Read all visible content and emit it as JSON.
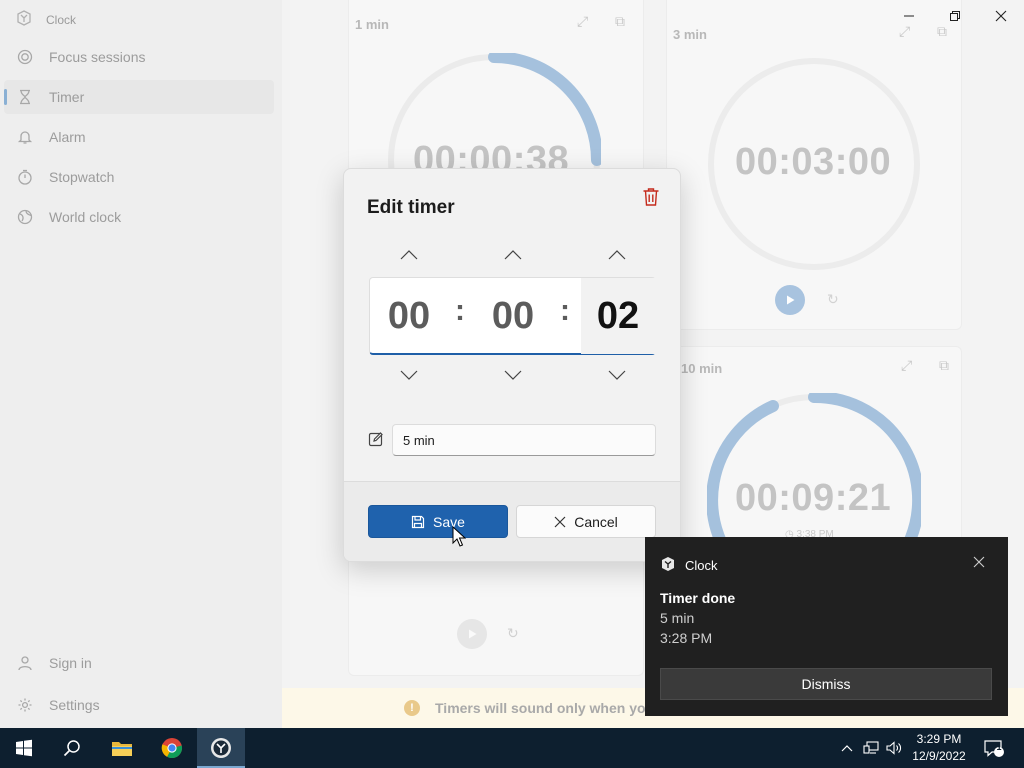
{
  "app": {
    "title": "Clock"
  },
  "sidebar": {
    "items": [
      {
        "label": "Focus sessions",
        "icon": "focus-icon"
      },
      {
        "label": "Timer",
        "icon": "hourglass-icon",
        "active": true
      },
      {
        "label": "Alarm",
        "icon": "bell-icon"
      },
      {
        "label": "Stopwatch",
        "icon": "stopwatch-icon"
      },
      {
        "label": "World clock",
        "icon": "globe-icon"
      }
    ],
    "bottom": [
      {
        "label": "Sign in",
        "icon": "person-icon"
      },
      {
        "label": "Settings",
        "icon": "gear-icon"
      }
    ]
  },
  "timers": [
    {
      "label": "1 min",
      "time": "00:00:38",
      "progress": 0.63
    },
    {
      "label": "3 min",
      "time": "00:03:00",
      "progress": 1.0
    },
    {
      "label": "10 min",
      "time": "00:09:21",
      "progress": 0.94,
      "end_time": "3:38 PM"
    }
  ],
  "info_bar": {
    "text": "Timers will sound only when you"
  },
  "dialog": {
    "title": "Edit timer",
    "hours": "00",
    "minutes": "00",
    "seconds": "02",
    "separator": ":",
    "name_value": "5 min",
    "save_label": "Save",
    "cancel_label": "Cancel"
  },
  "toast": {
    "app_name": "Clock",
    "title": "Timer done",
    "line1": "5 min",
    "line2": "3:28 PM",
    "button_label": "Dismiss"
  },
  "taskbar": {
    "time": "3:29 PM",
    "date": "12/9/2022",
    "notification_count": "1"
  },
  "colors": {
    "accent": "#1f62ad",
    "ring": "#8ab0d4",
    "toast_bg": "#202020",
    "taskbar_bg": "#0d1f2f",
    "delete": "#c42b1c"
  }
}
